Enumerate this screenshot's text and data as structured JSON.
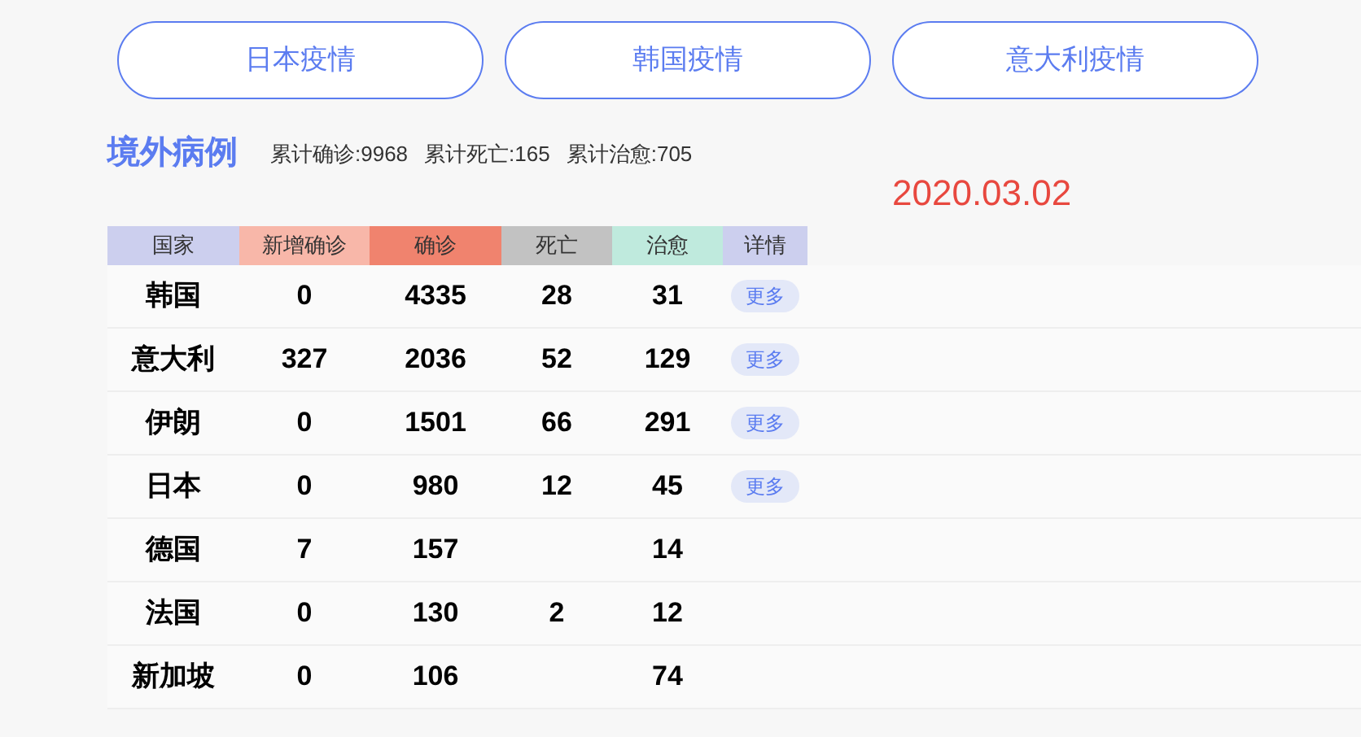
{
  "nav_buttons": [
    "日本疫情",
    "韩国疫情",
    "意大利疫情"
  ],
  "section": {
    "title": "境外病例",
    "stats": [
      "累计确诊:9968",
      "累计死亡:165",
      "累计治愈:705"
    ],
    "date": "2020.03.02"
  },
  "table": {
    "columns": [
      {
        "label": "国家",
        "color": "#cccfee"
      },
      {
        "label": "新增确诊",
        "color": "#f8b7a9"
      },
      {
        "label": "确诊",
        "color": "#f0836e"
      },
      {
        "label": "死亡",
        "color": "#c2c2c2"
      },
      {
        "label": "治愈",
        "color": "#bfeadd"
      },
      {
        "label": "详情",
        "color": "#cccfee"
      }
    ],
    "rows": [
      {
        "cells": [
          "韩国",
          "0",
          "4335",
          "28",
          "31"
        ],
        "more": "更多"
      },
      {
        "cells": [
          "意大利",
          "327",
          "2036",
          "52",
          "129"
        ],
        "more": "更多"
      },
      {
        "cells": [
          "伊朗",
          "0",
          "1501",
          "66",
          "291"
        ],
        "more": "更多"
      },
      {
        "cells": [
          "日本",
          "0",
          "980",
          "12",
          "45"
        ],
        "more": "更多"
      },
      {
        "cells": [
          "德国",
          "7",
          "157",
          "",
          "14"
        ]
      },
      {
        "cells": [
          "法国",
          "0",
          "130",
          "2",
          "12"
        ]
      },
      {
        "cells": [
          "新加坡",
          "0",
          "106",
          "",
          "74"
        ]
      }
    ]
  }
}
